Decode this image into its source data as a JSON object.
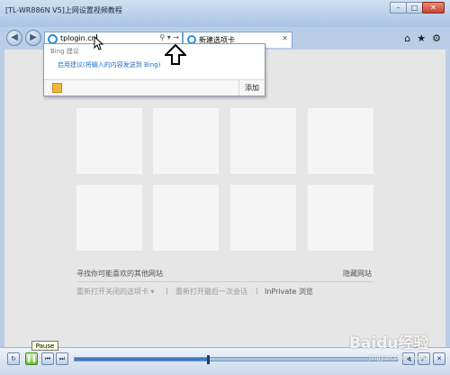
{
  "window": {
    "title": "[TL-WR886N V5]上网设置视频教程"
  },
  "browser": {
    "address": {
      "value": "tplogin.cn"
    },
    "tab": {
      "label": "新建选项卡"
    },
    "nav_icons": [
      "back-icon",
      "forward-icon"
    ],
    "toolbar_icons": [
      "home-icon",
      "star-icon",
      "gear-icon"
    ]
  },
  "dropdown": {
    "header": "Bing 建议",
    "suggestion": "启用建议(将输入的内容发送到 Bing)",
    "add_label": "添加"
  },
  "new_tab_page": {
    "find_sites": "寻找你可能喜欢的其他网站",
    "hidden_sites": "隐藏网站",
    "reopen_closed": "重新打开关闭的选项卡 ▾",
    "reopen_last": "重新打开最后一次会话",
    "inprivate": "InPrivate 浏览"
  },
  "player": {
    "tooltip": "Pause",
    "progress": 0.41,
    "watermark": "Baidu经验",
    "watermark_url": "jingyan.baidu.com"
  }
}
